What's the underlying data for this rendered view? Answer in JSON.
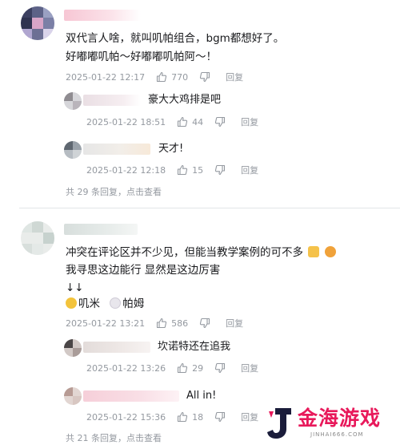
{
  "thread1": {
    "text_line1": "双代言人啥，就叫叽帕组合，bgm都想好了。",
    "text_line2": "好嘟嘟叽帕～好嘟嘟叽帕阿～！",
    "time": "2025-01-22 12:17",
    "likes": "770",
    "reply_label": "回复",
    "replies": [
      {
        "text": "豪大大鸡排是吧",
        "time": "2025-01-22 18:51",
        "likes": "44",
        "reply_label": "回复"
      },
      {
        "text": "天才!",
        "time": "2025-01-22 12:18",
        "likes": "15",
        "reply_label": "回复"
      }
    ],
    "more_count": "共 29 条回复，",
    "more_link": "点击查看"
  },
  "thread2": {
    "text_line1": "冲突在评论区并不少见，但能当教学案例的可不多",
    "text_line2": "我寻思这边能行 显然是这边厉害",
    "text_line3": "↓↓",
    "tag1": "叽米",
    "tag2": "帕姆",
    "time": "2025-01-22 13:21",
    "likes": "586",
    "reply_label": "回复",
    "replies": [
      {
        "text": "坎诺特还在追我",
        "time": "2025-01-22 13:26",
        "likes": "29",
        "reply_label": "回复"
      },
      {
        "text": "All in!",
        "time": "2025-01-22 15:36",
        "likes": "18",
        "reply_label": "回复"
      }
    ],
    "more_count": "共 21 条回复，",
    "more_link": "点击查看"
  },
  "watermark": {
    "brand": "金海游戏",
    "site": "JINHAI666.COM"
  }
}
